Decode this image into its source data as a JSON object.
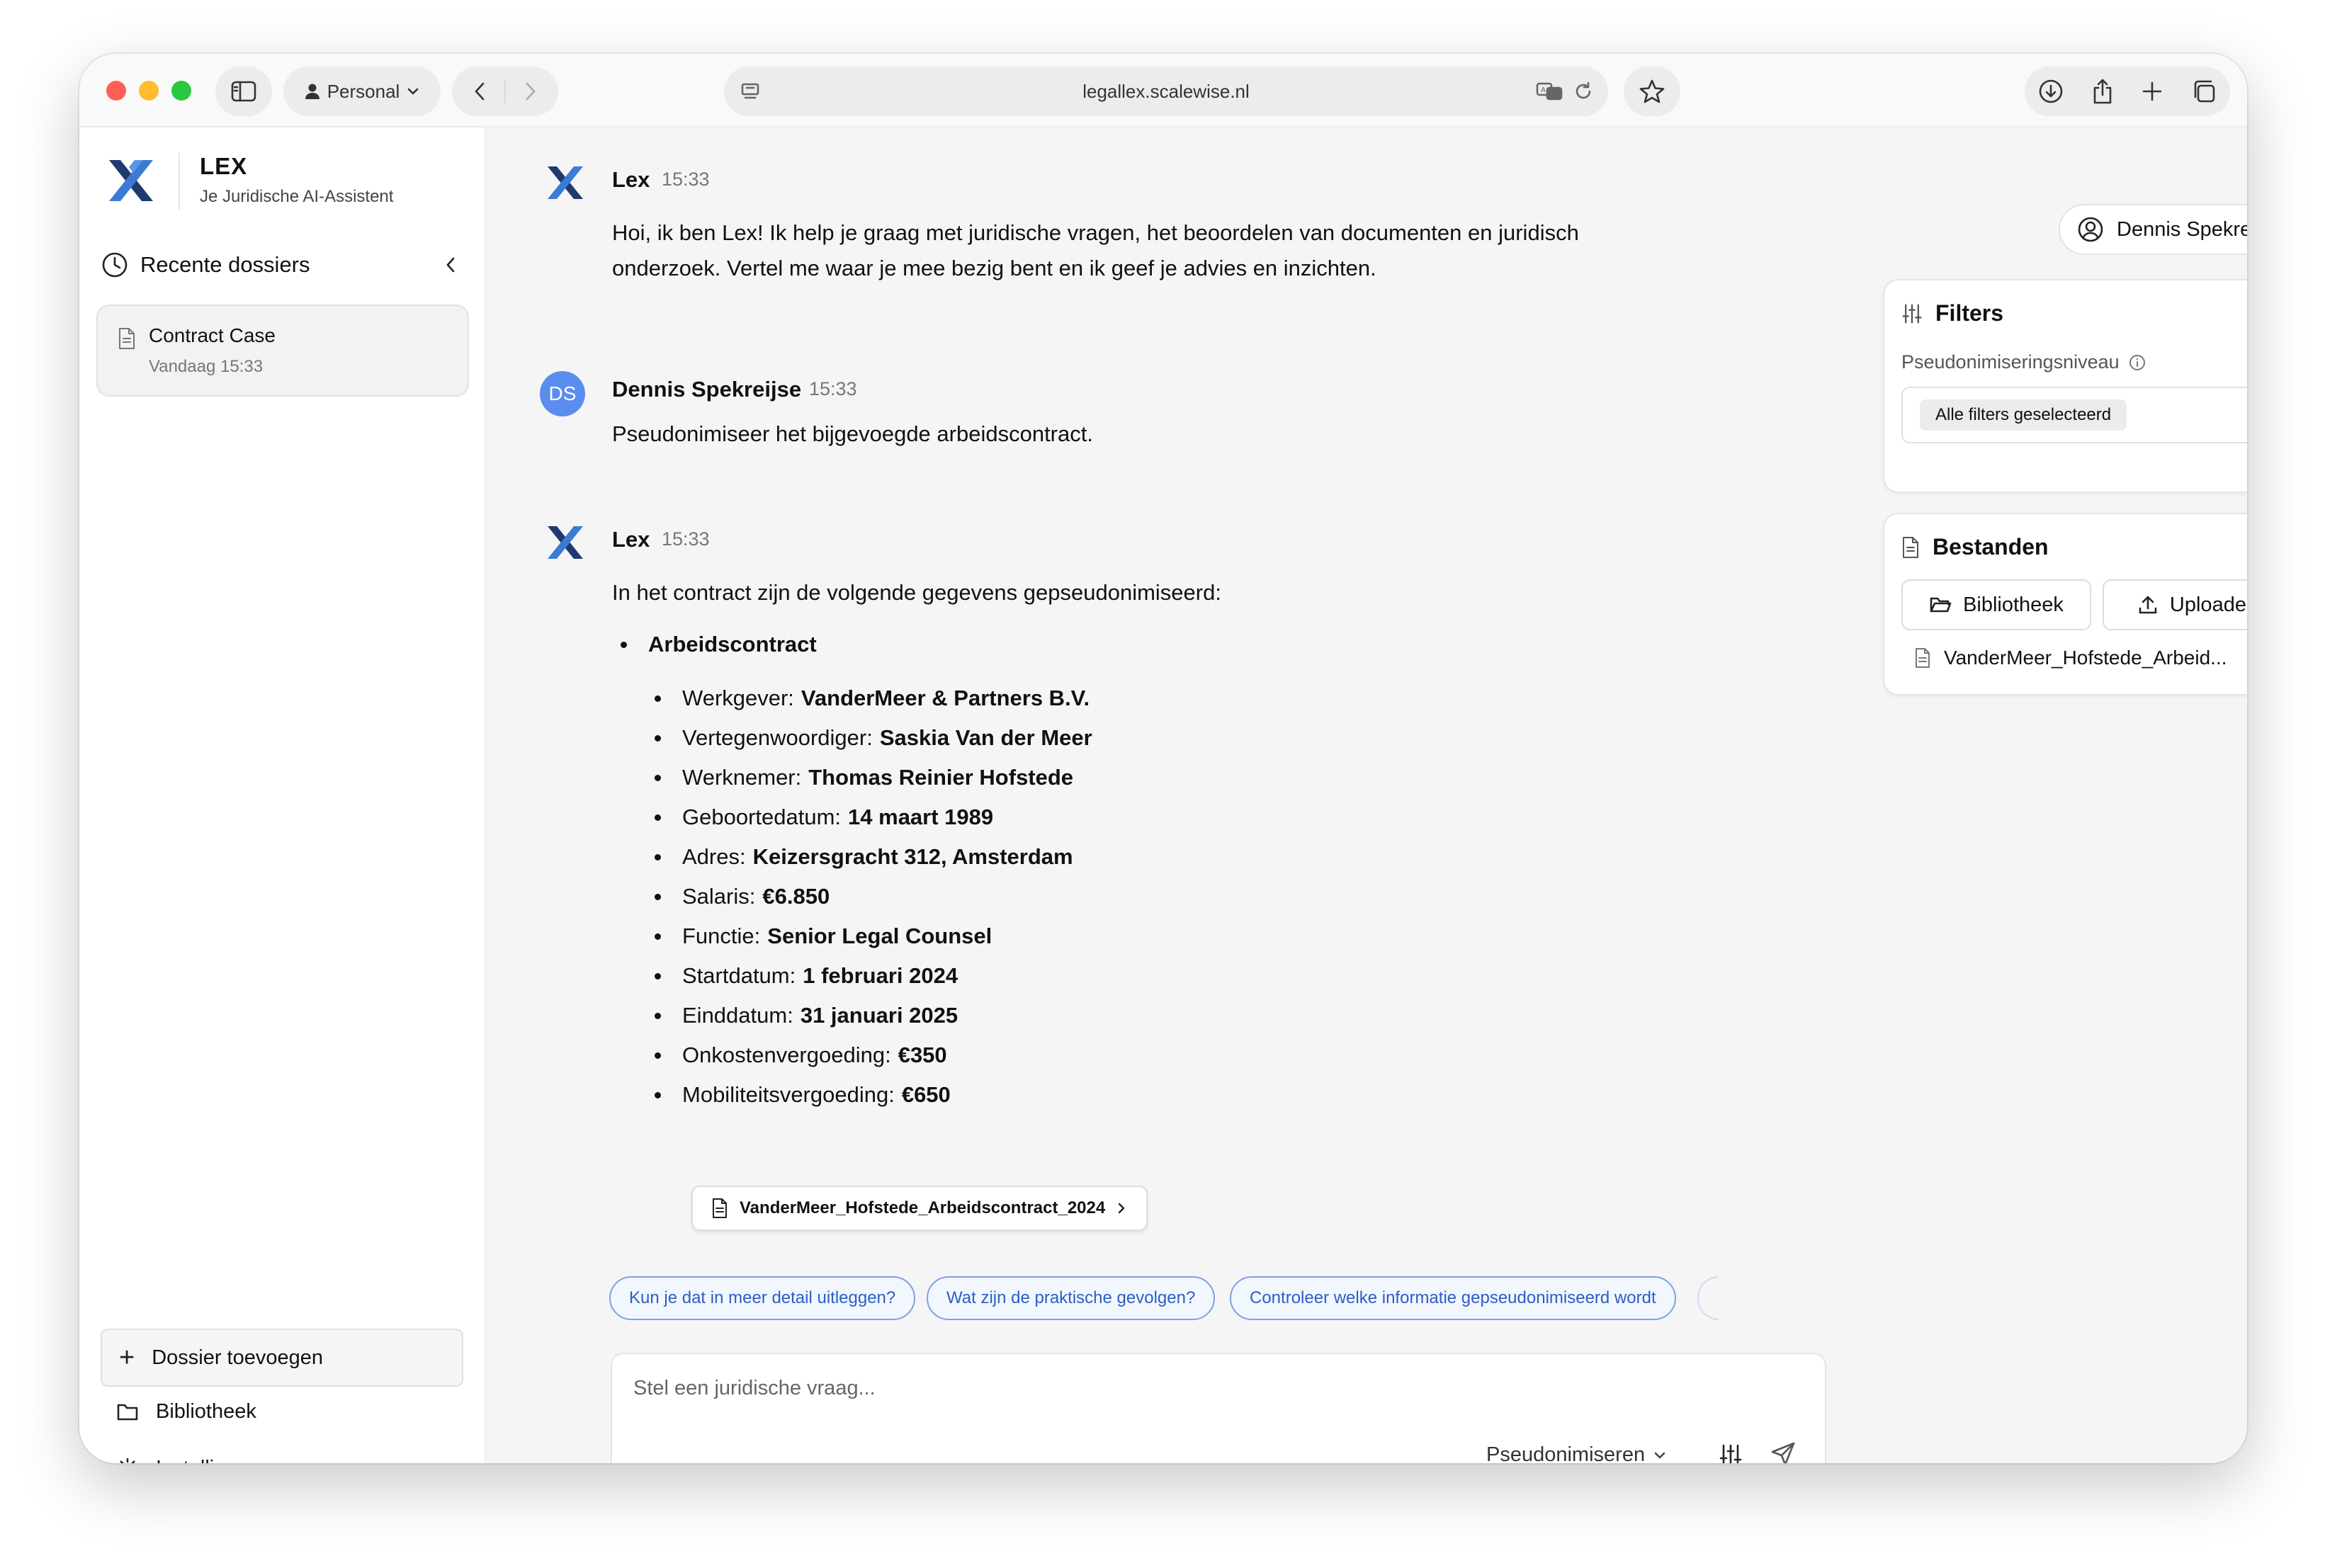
{
  "browser": {
    "profile": "Personal",
    "url": "legallex.scalewise.nl"
  },
  "sidebar": {
    "brand_name": "LEX",
    "brand_subtitle": "Je Juridische AI-Assistent",
    "recent_label": "Recente dossiers",
    "cases": [
      {
        "title": "Contract Case",
        "time": "Vandaag 15:33"
      }
    ],
    "add_dossier": "Dossier toevoegen",
    "library": "Bibliotheek",
    "settings": "Instellingen"
  },
  "chat": {
    "messages": [
      {
        "author": "Lex",
        "time": "15:33",
        "lines": [
          "Hoi, ik ben Lex! Ik help je graag met juridische vragen, het beoordelen van documenten en juridisch",
          "onderzoek. Vertel me waar je mee bezig bent en ik geef je advies en inzichten."
        ]
      },
      {
        "author": "Dennis Spekreijse",
        "initials": "DS",
        "time": "15:33",
        "text": "Pseudonimiseer het bijgevoegde arbeidscontract."
      },
      {
        "author": "Lex",
        "time": "15:33",
        "intro": "In het contract zijn de volgende gegevens gepseudonimiseerd:",
        "section": "Arbeidscontract",
        "items": [
          {
            "label": "Werkgever:",
            "value": "VanderMeer & Partners B.V."
          },
          {
            "label": "Vertegenwoordiger:",
            "value": "Saskia Van der Meer"
          },
          {
            "label": "Werknemer:",
            "value": "Thomas Reinier Hofstede"
          },
          {
            "label": "Geboortedatum:",
            "value": "14 maart 1989"
          },
          {
            "label": "Adres:",
            "value": "Keizersgracht 312, Amsterdam"
          },
          {
            "label": "Salaris:",
            "value": "€6.850"
          },
          {
            "label": "Functie:",
            "value": "Senior Legal Counsel"
          },
          {
            "label": "Startdatum:",
            "value": "1 februari 2024"
          },
          {
            "label": "Einddatum:",
            "value": "31 januari 2025"
          },
          {
            "label": "Onkostenvergoeding:",
            "value": "€350"
          },
          {
            "label": "Mobiliteitsvergoeding:",
            "value": "€650"
          }
        ],
        "attachment": "VanderMeer_Hofstede_Arbeidscontract_2024"
      }
    ],
    "suggestions": [
      "Kun je dat in meer detail uitleggen?",
      "Wat zijn de praktische gevolgen?",
      "Controleer welke informatie gepseudonimiseerd wordt"
    ],
    "composer": {
      "placeholder": "Stel een juridische vraag...",
      "mode": "Pseudonimiseren"
    }
  },
  "right_panel": {
    "user": "Dennis Spekreijse",
    "filters": {
      "title": "Filters",
      "level_label": "Pseudonimiseringsniveau",
      "selected": "Alle filters geselecteerd"
    },
    "files": {
      "title": "Bestanden",
      "library_btn": "Bibliotheek",
      "upload_btn": "Uploaden",
      "file_name": "VanderMeer_Hofstede_Arbeid...",
      "remove": "×"
    }
  },
  "colors": {
    "accent_blue": "#2a5fc4",
    "avatar_blue": "#5b8def",
    "logo_dark": "#1f3a6e",
    "logo_light": "#3b7bd4"
  }
}
